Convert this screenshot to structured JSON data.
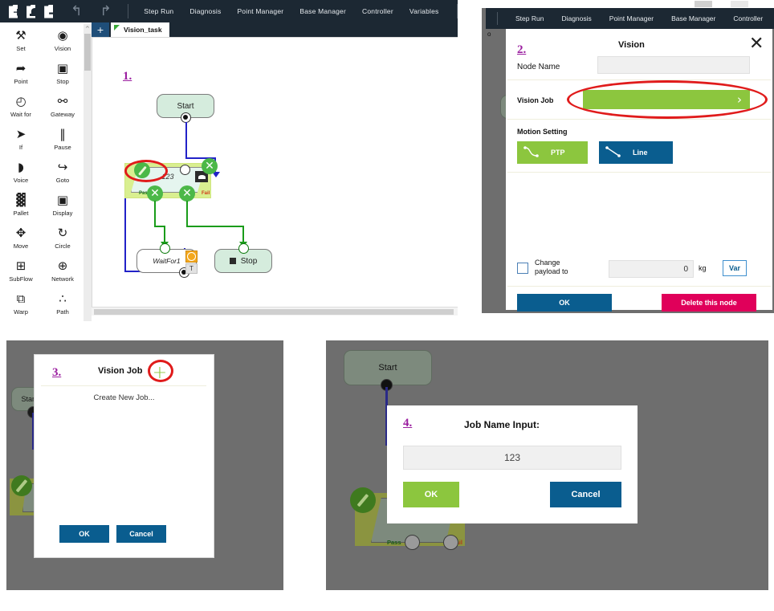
{
  "panel1": {
    "marker": "1.",
    "toolbar": {
      "icons": [
        "new-file-icon",
        "open-file-icon",
        "save-file-icon"
      ],
      "undo_icon": "↰",
      "redo_icon": "↱",
      "menu_items": [
        "Step Run",
        "Diagnosis",
        "Point Manager",
        "Base Manager",
        "Controller",
        "Variables"
      ]
    },
    "tab": {
      "plus": "+",
      "label": "Vision_task"
    },
    "palette": [
      {
        "label": "Set",
        "icon": "wrench-screwdriver-icon",
        "glyph": "⚒"
      },
      {
        "label": "Vision",
        "icon": "eye-icon",
        "glyph": "◉"
      },
      {
        "label": "Point",
        "icon": "point-teach-icon",
        "glyph": "➦"
      },
      {
        "label": "Stop",
        "icon": "stop-square-icon",
        "glyph": "▣"
      },
      {
        "label": "Wait for",
        "icon": "clock-icon",
        "glyph": "◴"
      },
      {
        "label": "Gateway",
        "icon": "gateway-hierarchy-icon",
        "glyph": "⚯"
      },
      {
        "label": "If",
        "icon": "branch-if-icon",
        "glyph": "➤"
      },
      {
        "label": "Pause",
        "icon": "pause-icon",
        "glyph": "‖"
      },
      {
        "label": "Voice",
        "icon": "voice-speaker-icon",
        "glyph": "◗"
      },
      {
        "label": "Goto",
        "icon": "goto-arrow-icon",
        "glyph": "↪"
      },
      {
        "label": "Pallet",
        "icon": "pallet-grid-icon",
        "glyph": "▓"
      },
      {
        "label": "Display",
        "icon": "display-monitor-icon",
        "glyph": "▣"
      },
      {
        "label": "Move",
        "icon": "move-cross-icon",
        "glyph": "✥"
      },
      {
        "label": "Circle",
        "icon": "circle-arc-icon",
        "glyph": "↻"
      },
      {
        "label": "SubFlow",
        "icon": "subflow-icon",
        "glyph": "⊞"
      },
      {
        "label": "Network",
        "icon": "globe-network-icon",
        "glyph": "⊕"
      },
      {
        "label": "Warp",
        "icon": "warp-copy-icon",
        "glyph": "⧉"
      },
      {
        "label": "Path",
        "icon": "path-nodes-icon",
        "glyph": "∴"
      }
    ],
    "flow": {
      "start_node": "Start",
      "vision_node_name": "123",
      "pass_label": "Pass",
      "fail_label": "Fail",
      "wait_node": "WaitFor1",
      "stop_node": "Stop",
      "x_buttons": "✕",
      "edit_badge": "pencil-icon",
      "camera_badge": "camera-icon",
      "clock_badge": "clock-icon",
      "t_badge": "T"
    }
  },
  "panel2": {
    "marker": "2.",
    "menu_items": [
      "Step Run",
      "Diagnosis",
      "Point Manager",
      "Base Manager",
      "Controller"
    ],
    "dialog": {
      "title": "Vision",
      "close_icon": "✕",
      "node_name_label": "Node Name",
      "node_name_value": "",
      "vision_job_label": "Vision Job",
      "vision_job_value": "",
      "vision_job_chevron": "›",
      "motion_setting_label": "Motion Setting",
      "ptp_label": "PTP",
      "line_label": "Line",
      "change_payload_label_1": "Change",
      "change_payload_label_2": "payload to",
      "payload_value": "0",
      "payload_unit": "kg",
      "var_label": "Var",
      "ok_label": "OK",
      "delete_label": "Delete this node"
    },
    "background_text": "o"
  },
  "panel3": {
    "marker": "3.",
    "dialog": {
      "title": "Vision Job",
      "add_icon": "+",
      "list_item": "Create New Job...",
      "ok_label": "OK",
      "cancel_label": "Cancel"
    },
    "background": {
      "start_node": "Start"
    }
  },
  "panel4": {
    "marker": "4.",
    "dialog": {
      "title": "Job Name Input:",
      "input_value": "123",
      "ok_label": "OK",
      "cancel_label": "Cancel"
    },
    "background": {
      "start_node": "Start",
      "pass_label": "Pass",
      "fail_label": "Fail"
    }
  },
  "colors": {
    "dark_chrome": "#1c2833",
    "accent_green": "#8cc63e",
    "accent_blue": "#0a5d8f",
    "accent_pink": "#e0005a",
    "annotation_red": "#e01b1b",
    "marker_purple": "#9b1fa0",
    "overlay_gray": "#6e6e6e"
  }
}
